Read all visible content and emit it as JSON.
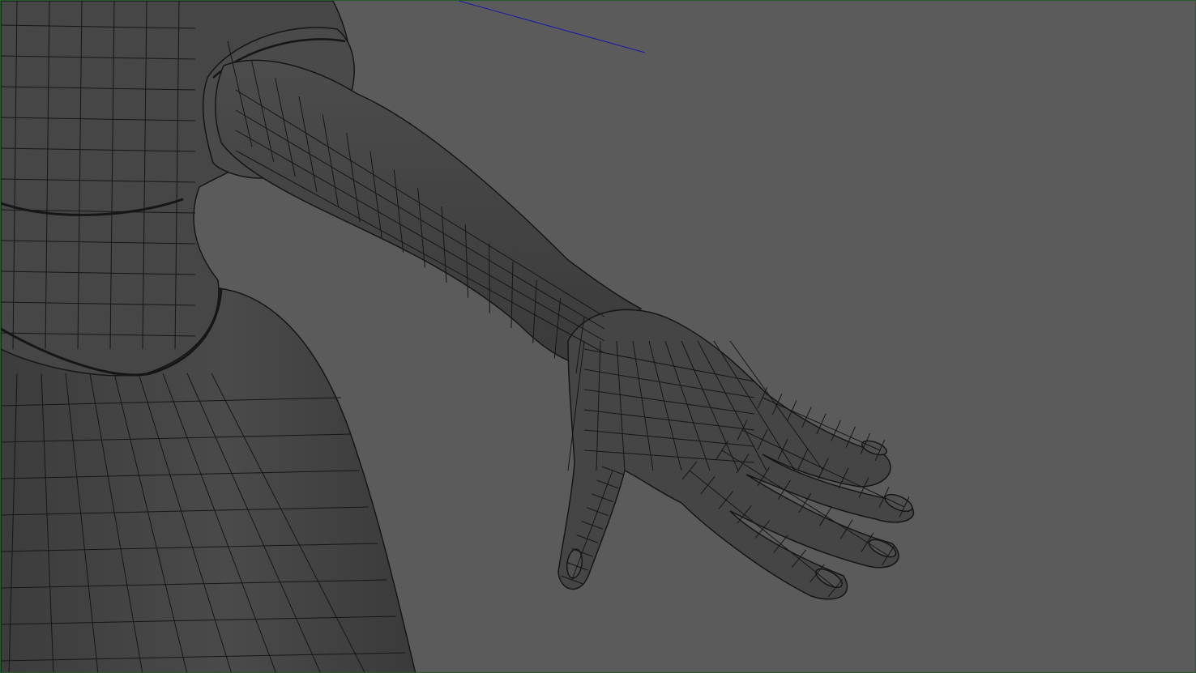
{
  "viewport": {
    "name": "3d-viewport",
    "shading_mode": "wireframe-on-shaded",
    "background_color": "#5b5b5b",
    "border_color": "#1f5d2a",
    "mesh_fill_color": "#474747",
    "wire_color": "#161616",
    "axis_line_color": "#1a1aa8"
  },
  "scene": {
    "object": "character-mesh",
    "visible_parts": [
      "torso",
      "upper-arm-sleeve",
      "forearm",
      "hand",
      "thumb",
      "index-finger",
      "middle-finger",
      "ring-finger",
      "pinky-finger",
      "skirt"
    ]
  }
}
